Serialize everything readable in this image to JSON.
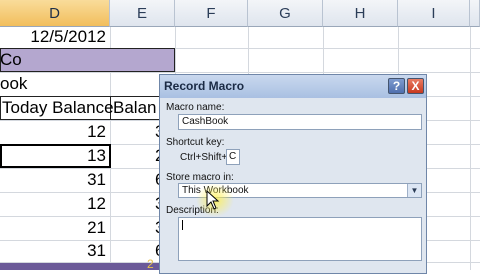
{
  "columns": [
    "D",
    "E",
    "F",
    "G",
    "H",
    "I"
  ],
  "sheet": {
    "date": "12/5/2012",
    "company_fragment": "Co",
    "book_fragment": "ook",
    "headers": {
      "today_balance": "Today Balance",
      "balance_partial": "Balan"
    },
    "rows": [
      {
        "today": "12",
        "e_partial": "3"
      },
      {
        "today": "13",
        "e_partial": "2"
      },
      {
        "today": "31",
        "e_partial": "6"
      },
      {
        "today": "12",
        "e_partial": "3"
      },
      {
        "today": "21",
        "e_partial": "3"
      },
      {
        "today": "31",
        "e_partial": "6"
      }
    ],
    "total_fragment": "2"
  },
  "dialog": {
    "title": "Record Macro",
    "help_btn": "?",
    "close_btn": "X",
    "macro_name_label": "Macro name:",
    "macro_name_value": "CashBook",
    "shortcut_label": "Shortcut key:",
    "shortcut_prefix": "Ctrl+Shift+",
    "shortcut_value": "C",
    "store_label": "Store macro in:",
    "store_value": "This Workbook",
    "description_label": "Description:",
    "description_value": ""
  },
  "colors": {
    "accent_band": "#b4a7cf",
    "selected_header": "#f2be5c",
    "close_button": "#d9462f"
  }
}
